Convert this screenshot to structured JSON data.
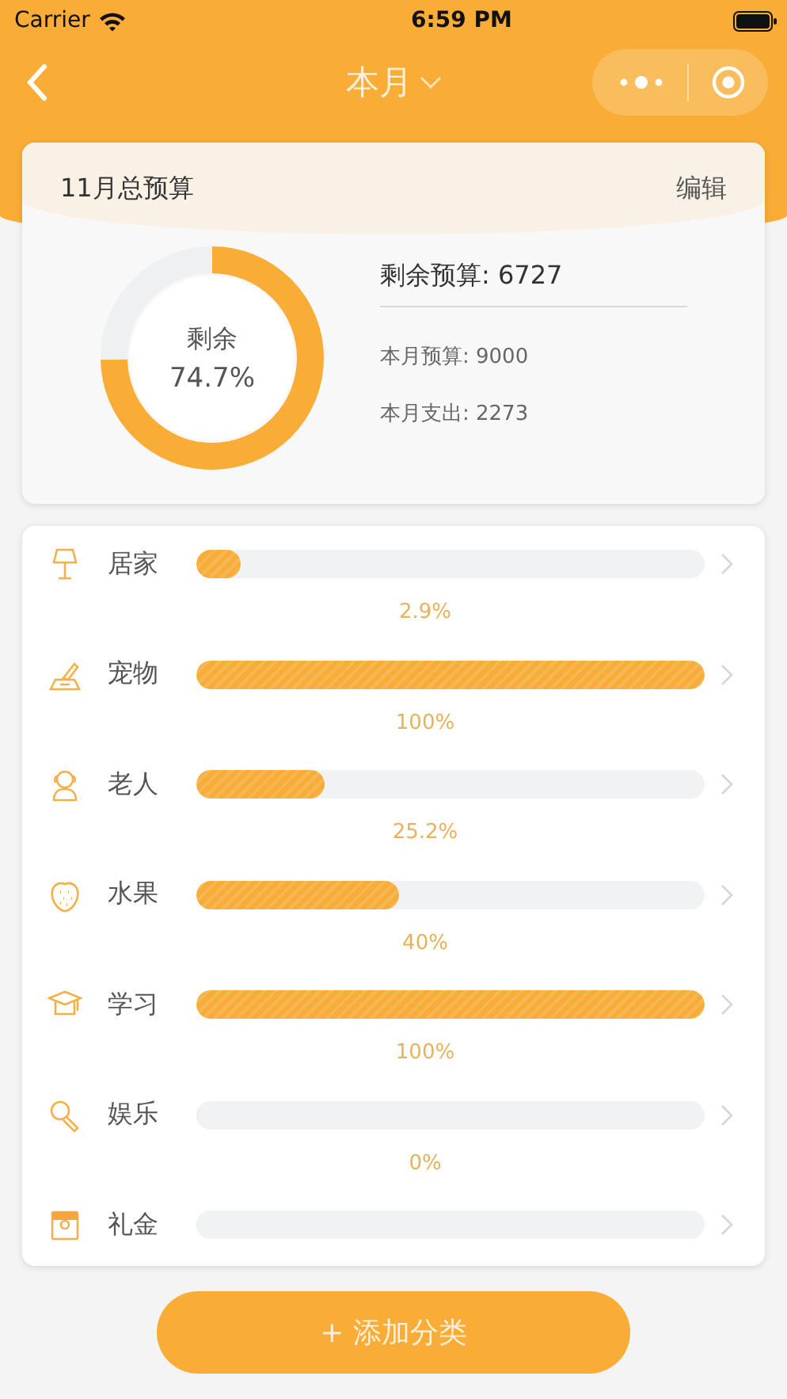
{
  "status_bar": {
    "carrier": "Carrier",
    "time": "6:59 PM"
  },
  "nav": {
    "title": "本月"
  },
  "summary": {
    "title": "11月总预算",
    "edit": "编辑",
    "ring_label": "剩余",
    "ring_value": "74.7%",
    "level": 0.747,
    "remaining": "剩余预算: 6727",
    "budget": "本月预算: 9000",
    "spent": "本月支出: 2273"
  },
  "categories": [
    {
      "name": "居家",
      "level": 0.029,
      "percent": "2.9%"
    },
    {
      "name": "宠物",
      "level": 1,
      "percent": "100%"
    },
    {
      "name": "老人",
      "level": 0.252,
      "percent": "25.2%"
    },
    {
      "name": "水果",
      "level": 0.4,
      "percent": "40%"
    },
    {
      "name": "学习",
      "level": 1,
      "percent": "100%"
    },
    {
      "name": "娱乐",
      "level": 0,
      "percent": "0%"
    },
    {
      "name": "礼金",
      "level": 0
    }
  ],
  "add_button": "+ 添加分类"
}
